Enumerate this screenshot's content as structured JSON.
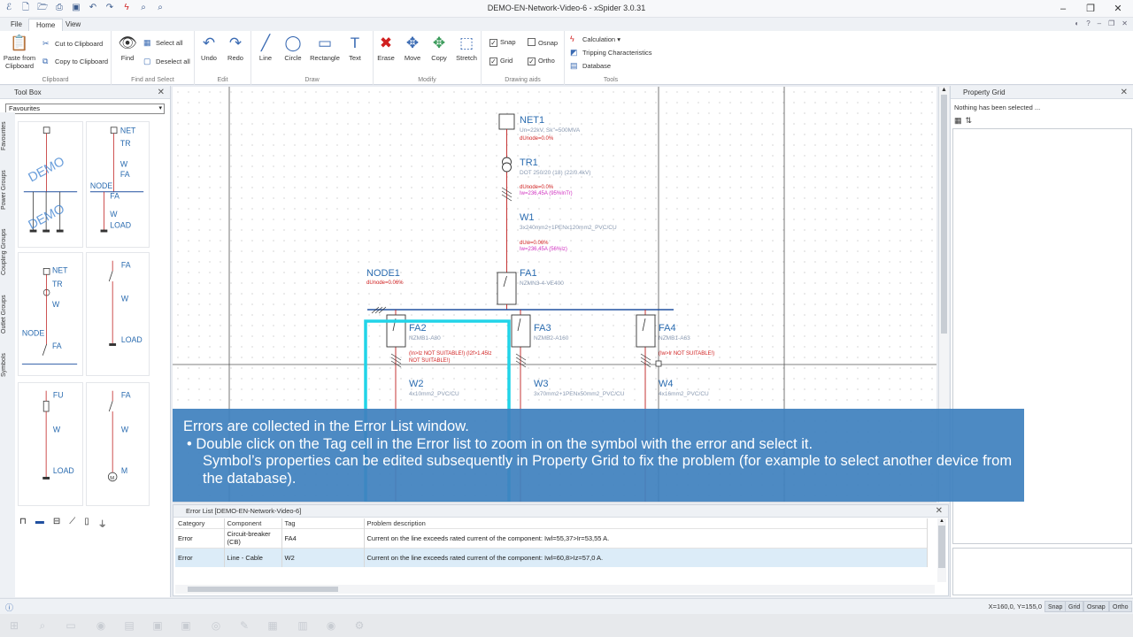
{
  "app": {
    "title": "DEMO-EN-Network-Video-6 - xSpider 3.0.31"
  },
  "tabs": [
    "File",
    "Home",
    "View"
  ],
  "ribbon": {
    "clipboard": {
      "paste": "Paste from Clipboard",
      "cut": "Cut to Clipboard",
      "copy": "Copy to Clipboard",
      "label": "Clipboard"
    },
    "find": {
      "find": "Find",
      "select_all": "Select all",
      "deselect_all": "Deselect all",
      "label": "Find and Select"
    },
    "edit": {
      "undo": "Undo",
      "redo": "Redo",
      "label": "Edit"
    },
    "draw": {
      "line": "Line",
      "circle": "Circle",
      "rectangle": "Rectangle",
      "text": "Text",
      "label": "Draw"
    },
    "modify": {
      "erase": "Erase",
      "move": "Move",
      "copy": "Copy",
      "stretch": "Stretch",
      "label": "Modify"
    },
    "drawing_aids": {
      "snap": "Snap",
      "osnap": "Osnap",
      "grid": "Grid",
      "ortho": "Ortho",
      "label": "Drawing aids"
    },
    "tools": {
      "calculation": "Calculation",
      "tripping": "Tripping Characteristics",
      "database": "Database",
      "label": "Tools"
    }
  },
  "toolbox": {
    "title": "Tool Box",
    "selected": "Favourites",
    "vertical_tabs": [
      "Favourites",
      "Power Groups",
      "Coupling Groups",
      "Outlet Groups",
      "Symbols"
    ],
    "symbols": {
      "s1": {
        "watermark": "DEMO"
      },
      "s2": {
        "net": "NET",
        "tr": "TR",
        "w": "W",
        "fa": "FA",
        "node": "NODE",
        "fa2": "FA",
        "w2": "W",
        "load": "LOAD",
        "watermark": "DEMO"
      },
      "s3": {
        "net": "NET",
        "tr": "TR",
        "w": "W",
        "node": "NODE",
        "fa": "FA"
      },
      "s4": {
        "fa": "FA",
        "w": "W",
        "load": "LOAD"
      },
      "s5": {
        "fu": "FU",
        "w": "W",
        "load": "LOAD"
      },
      "s6": {
        "fa": "FA",
        "w": "W",
        "m": "M"
      }
    }
  },
  "diagram": {
    "net1": {
      "name": "NET1",
      "params": "Un=22kV, Sk''=500MVA",
      "drop": "dUnode=0.0%"
    },
    "tr1": {
      "name": "TR1",
      "params": "DOT 250/20 (18) (22/0.4kV)",
      "drop": "dUnode=0.0%",
      "current": "Iw=236,45A (95%InTr)"
    },
    "w1": {
      "name": "W1",
      "params": "3x240mm2+1PENx120mm2_PVC/CU",
      "drop": "dUw=0.06%",
      "current": "Iw=236,45A (56%Iz)"
    },
    "fa1": {
      "name": "FA1",
      "params": "NZMN3-4-VE400"
    },
    "node1": {
      "name": "NODE1",
      "drop": "dUnode=0.06%"
    },
    "fa2": {
      "name": "FA2",
      "params": "NZMB1-A80",
      "error1": "(In>Iz NOT SUITABLE!) (I2f>1.45Iz",
      "error2": "NOT SUITABLE!)"
    },
    "fa3": {
      "name": "FA3",
      "params": "NZMB2-A160"
    },
    "fa4": {
      "name": "FA4",
      "params": "NZMB1-A63",
      "error": "(Iw>Ir NOT SUITABLE!)"
    },
    "w2": {
      "name": "W2",
      "params": "4x10mm2_PVC/CU"
    },
    "w3": {
      "name": "W3",
      "params": "3x70mm2+1PENx50mm2_PVC/CU"
    },
    "w4": {
      "name": "W4",
      "params": "4x16mm2_PVC/CU"
    }
  },
  "overlay": {
    "line1": "Errors are collected in the Error List window.",
    "line2": "• Double click on the Tag cell in the Error list to zoom in on the symbol with the error and select it.",
    "line3": "Symbol’s properties can be edited subsequently in Property Grid to fix the problem (for example to select another device from the database)."
  },
  "error_list": {
    "title": "Error List [DEMO-EN-Network-Video-6]",
    "columns": [
      "Category",
      "Component",
      "Tag",
      "Problem description"
    ],
    "rows": [
      {
        "category": "Error",
        "component": "Circuit-breaker (CB)",
        "tag": "FA4",
        "description": "Current on the line exceeds rated current of the component: Iwl=55,37>Ir=53,55 A."
      },
      {
        "category": "Error",
        "component": "Line - Cable",
        "tag": "W2",
        "description": "Current on the line exceeds rated current of the component: Iwl=60,8>Iz=57,0 A."
      }
    ]
  },
  "property_grid": {
    "title": "Property Grid",
    "status": "Nothing has been selected ..."
  },
  "statusbar": {
    "coords": "X=160,0, Y=155,0",
    "buttons": [
      "Snap",
      "Grid",
      "Osnap",
      "Ortho"
    ]
  },
  "colors": {
    "accent": "#2b6cb0",
    "highlight": "#21d4e8",
    "error": "#d02020",
    "overlay": "#3f81be"
  }
}
